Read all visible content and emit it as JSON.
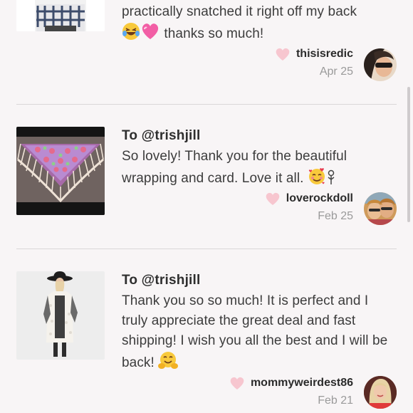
{
  "items": [
    {
      "to": "",
      "text_line1": "practically snatched it right off my back",
      "text_line2": "thanks so much!",
      "username": "thisisredic",
      "date": "Apr 25"
    },
    {
      "to": "To @trishjill",
      "text": "So lovely! Thank you for the beautiful wrapping and card. Love it all.",
      "username": "loverockdoll",
      "date": "Feb 25"
    },
    {
      "to": "To @trishjill",
      "text": "Thank you so so much! It is perfect and I truly appreciate the great deal and fast shipping! I wish you all the best and I will be back!",
      "username": "mommyweirdest86",
      "date": "Feb 21"
    }
  ],
  "colors": {
    "background": "#f8f5f6",
    "heart": "#f7c6cf",
    "divider": "#dad6d8",
    "date": "#9a9a9a"
  },
  "icons": [
    "heart-icon",
    "laughing-emoji-icon",
    "pink-heart-emoji-icon",
    "smiling-hearts-emoji-icon",
    "flower-icon",
    "hugging-emoji-icon"
  ]
}
